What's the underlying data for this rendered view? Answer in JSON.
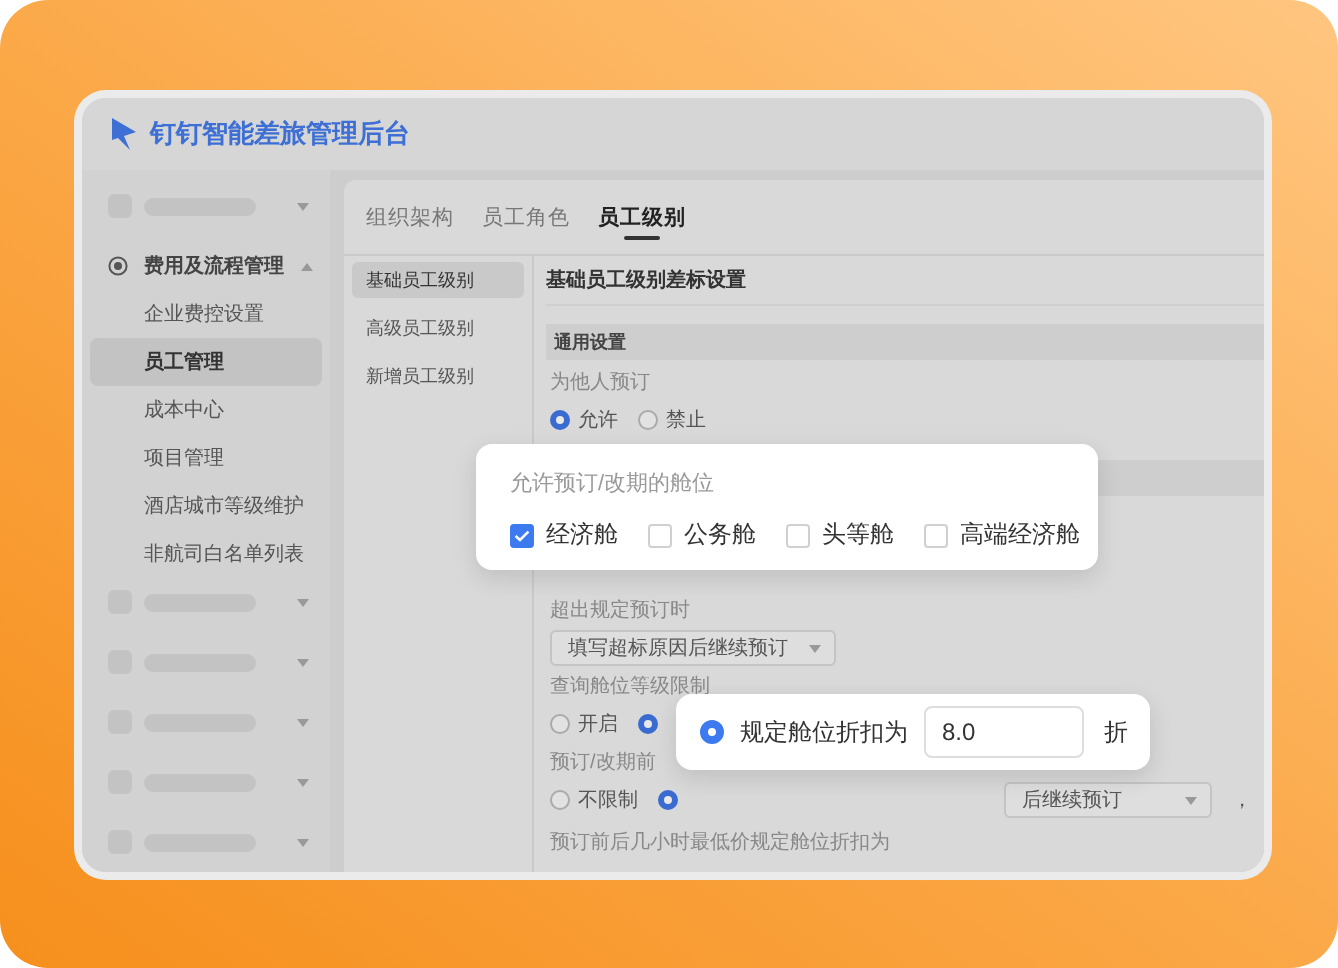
{
  "window": {
    "title": "钉钉智能差旅管理后台"
  },
  "sidebar": {
    "items": [
      {
        "kind": "skeleton"
      },
      {
        "kind": "group",
        "label": "费用及流程管理",
        "expanded": true,
        "children": [
          {
            "label": "企业费控设置",
            "selected": false
          },
          {
            "label": "员工管理",
            "selected": true
          },
          {
            "label": "成本中心",
            "selected": false
          },
          {
            "label": "项目管理",
            "selected": false
          },
          {
            "label": "酒店城市等级维护",
            "selected": false
          },
          {
            "label": "非航司白名单列表",
            "selected": false
          }
        ]
      },
      {
        "kind": "skeleton"
      },
      {
        "kind": "skeleton"
      },
      {
        "kind": "skeleton"
      },
      {
        "kind": "skeleton"
      },
      {
        "kind": "skeleton"
      }
    ]
  },
  "tabs": [
    {
      "label": "组织架构",
      "selected": false
    },
    {
      "label": "员工角色",
      "selected": false
    },
    {
      "label": "员工级别",
      "selected": true
    }
  ],
  "subnav": [
    {
      "label": "基础员工级别",
      "selected": true
    },
    {
      "label": "高级员工级别",
      "selected": false
    },
    {
      "label": "新增员工级别",
      "selected": false
    }
  ],
  "main": {
    "heading": "基础员工级别差标设置",
    "section": "通用设置",
    "fields": [
      {
        "kind": "radio",
        "label": "为他人预订",
        "options": [
          {
            "label": "允许",
            "selected": true
          },
          {
            "label": "禁止",
            "selected": false
          }
        ]
      },
      {
        "kind": "section_bar"
      },
      {
        "kind": "select",
        "label": "超出规定预订时",
        "value": "填写超标原因后继续预订"
      },
      {
        "kind": "radio",
        "label": "查询舱位等级限制",
        "options": [
          {
            "label": "开启",
            "selected": false
          },
          {
            "selected": true
          }
        ]
      },
      {
        "kind": "radio",
        "label": "预订/改期前",
        "options": [
          {
            "label": "不限制",
            "selected": false
          },
          {
            "selected": true
          }
        ],
        "select_value": "后继续预订",
        "suffix": "，"
      },
      {
        "kind": "note",
        "label": "预订前后几小时最低价规定舱位折扣为"
      }
    ]
  },
  "popups": [
    {
      "kind": "checkboxes",
      "title": "允许预订/改期的舱位",
      "options": [
        {
          "label": "经济舱",
          "checked": true
        },
        {
          "label": "公务舱",
          "checked": false
        },
        {
          "label": "头等舱",
          "checked": false
        },
        {
          "label": "高端经济舱",
          "checked": false
        }
      ]
    },
    {
      "kind": "discount",
      "selected": true,
      "label": "规定舱位折扣为",
      "value": "8.0",
      "unit": "折"
    }
  ]
}
